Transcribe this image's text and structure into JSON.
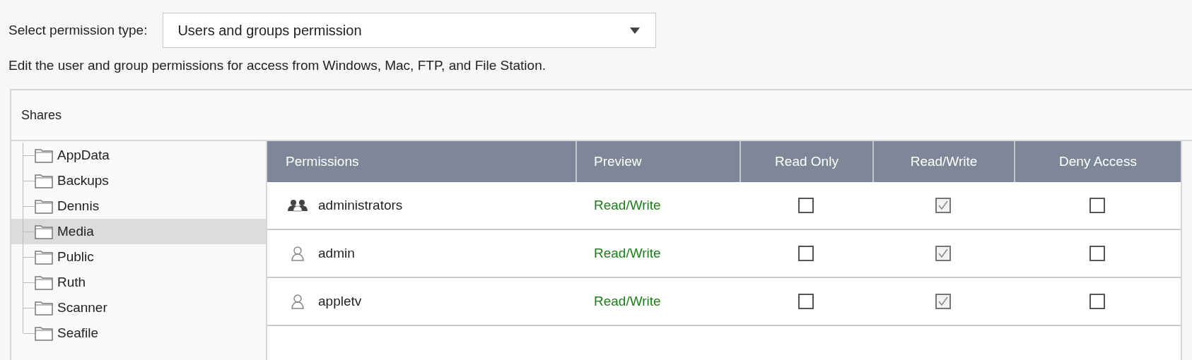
{
  "permission_type": {
    "label": "Select permission type:",
    "value": "Users and groups permission"
  },
  "description": "Edit the user and group permissions for access from Windows, Mac, FTP, and File Station.",
  "panel": {
    "title": "Shares"
  },
  "shares": [
    {
      "name": "AppData",
      "selected": false
    },
    {
      "name": "Backups",
      "selected": false
    },
    {
      "name": "Dennis",
      "selected": false
    },
    {
      "name": "Media",
      "selected": true
    },
    {
      "name": "Public",
      "selected": false
    },
    {
      "name": "Ruth",
      "selected": false
    },
    {
      "name": "Scanner",
      "selected": false
    },
    {
      "name": "Seafile",
      "selected": false
    }
  ],
  "table": {
    "columns": [
      "Permissions",
      "Preview",
      "Read Only",
      "Read/Write",
      "Deny Access"
    ],
    "rows": [
      {
        "kind": "group",
        "name": "administrators",
        "preview": "Read/Write",
        "read_only": false,
        "read_write": true,
        "deny_access": false
      },
      {
        "kind": "user",
        "name": "admin",
        "preview": "Read/Write",
        "read_only": false,
        "read_write": true,
        "deny_access": false
      },
      {
        "kind": "user",
        "name": "appletv",
        "preview": "Read/Write",
        "read_only": false,
        "read_write": true,
        "deny_access": false
      }
    ]
  }
}
